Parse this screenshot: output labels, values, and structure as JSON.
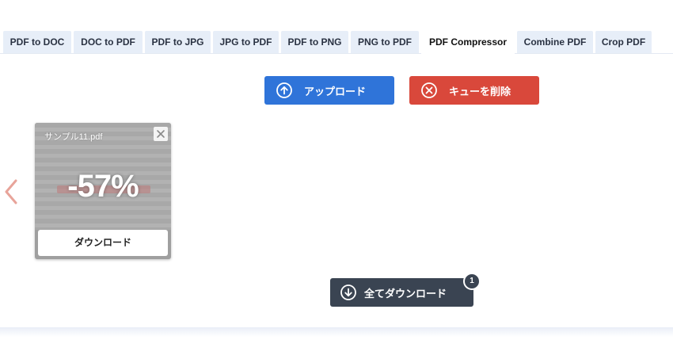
{
  "tabs": [
    {
      "label": "PDF to DOC",
      "active": false
    },
    {
      "label": "DOC to PDF",
      "active": false
    },
    {
      "label": "PDF to JPG",
      "active": false
    },
    {
      "label": "JPG to PDF",
      "active": false
    },
    {
      "label": "PDF to PNG",
      "active": false
    },
    {
      "label": "PNG to PDF",
      "active": false
    },
    {
      "label": "PDF Compressor",
      "active": true
    },
    {
      "label": "Combine PDF",
      "active": false
    },
    {
      "label": "Crop PDF",
      "active": false
    }
  ],
  "toolbar": {
    "upload_label": "アップロード",
    "upload_icon": "upload-circle-icon",
    "clear_label": "キューを削除",
    "clear_icon": "close-circle-icon"
  },
  "queue": {
    "prev_icon": "chevron-left-icon",
    "files": [
      {
        "name": "サンプル11.pdf",
        "reduction": "-57%",
        "download_label": "ダウンロード"
      }
    ]
  },
  "download_all": {
    "label": "全てダウンロード",
    "icon": "download-circle-icon",
    "count": "1"
  },
  "colors": {
    "upload": "#2f74d9",
    "clear": "#d9483b",
    "download_all": "#3a4452",
    "tab_bg": "#e7eef8",
    "chevron": "#e8a49a"
  }
}
